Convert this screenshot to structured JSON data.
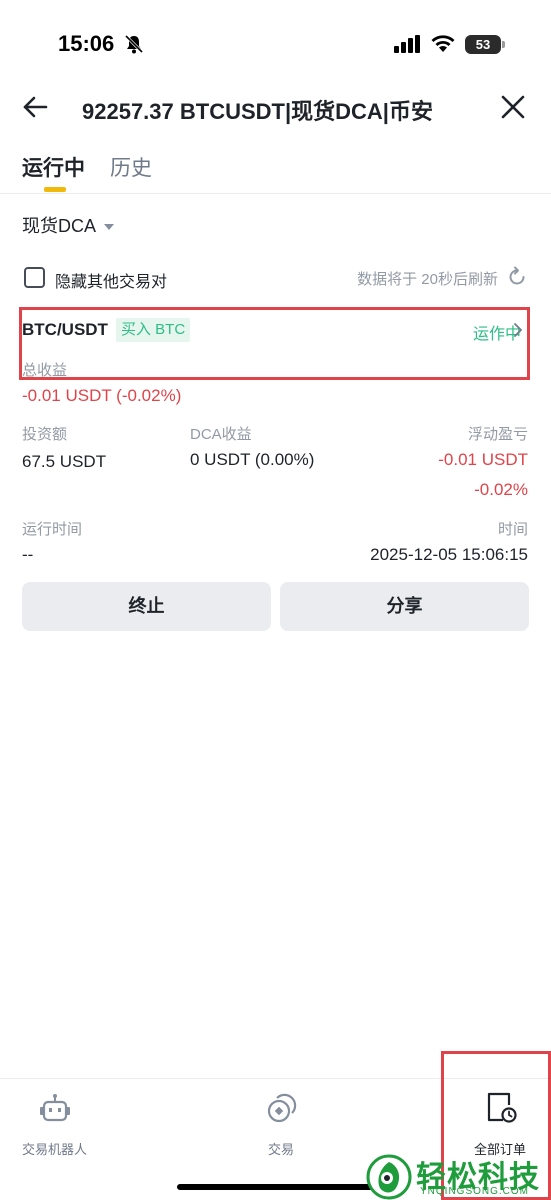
{
  "status_bar": {
    "time": "15:06",
    "battery": "53"
  },
  "header": {
    "title": "92257.37 BTCUSDT|现货DCA|币安"
  },
  "tabs": [
    {
      "label": "运行中"
    },
    {
      "label": "历史"
    }
  ],
  "filter": {
    "selected": "现货DCA"
  },
  "options": {
    "hide_other_pairs": "隐藏其他交易对",
    "refresh_note": "数据将于 20秒后刷新"
  },
  "order": {
    "pair": "BTC/USDT",
    "side": "买入 BTC",
    "status": "运作中",
    "total_pnl_label": "总收益",
    "total_pnl_value": "-0.01 USDT (-0.02%)",
    "investment_label": "投资额",
    "investment_value": "67.5 USDT",
    "dca_pnl_label": "DCA收益",
    "dca_pnl_value": "0 USDT (0.00%)",
    "floating_pnl_label": "浮动盈亏",
    "floating_pnl_value": "-0.01 USDT",
    "floating_pnl_pct": "-0.02%",
    "runtime_label": "运行时间",
    "runtime_value": "--",
    "time_label": "时间",
    "time_value": "2025-12-05 15:06:15",
    "stop_button": "终止",
    "share_button": "分享"
  },
  "bottom_nav": [
    {
      "label": "交易机器人",
      "icon": "robot-icon"
    },
    {
      "label": "交易",
      "icon": "trade-icon"
    },
    {
      "label": "全部订单",
      "icon": "orders-icon"
    }
  ],
  "watermark": {
    "title": "轻松科技",
    "sub": "YNQINGSONG.COM"
  },
  "colors": {
    "accent": "#f0b90b",
    "green": "#2ebd85",
    "red": "#e0444a",
    "highlight": "#e0444a"
  }
}
